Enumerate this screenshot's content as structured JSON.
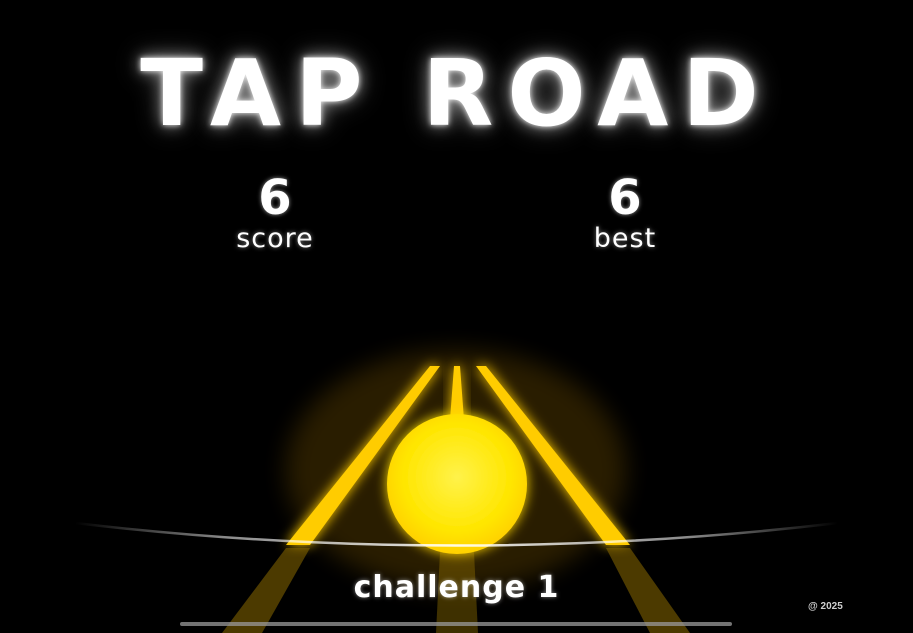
{
  "game": {
    "title": "TAP ROAD",
    "score": {
      "value": "6",
      "label": "score"
    },
    "best": {
      "value": "6",
      "label": "best"
    },
    "level_label": "challenge 1",
    "copyright": "@ 2025"
  },
  "colors": {
    "background": "#000000",
    "road_glow": "#ffd21a",
    "ball": "#ffee00",
    "text": "#ffffff"
  }
}
